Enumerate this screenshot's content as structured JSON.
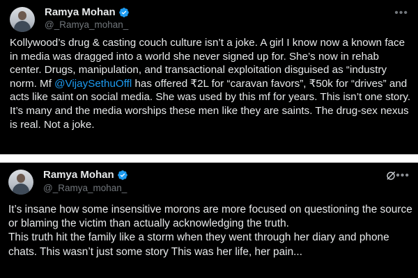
{
  "colors": {
    "background": "#000000",
    "text": "#e7e9ea",
    "muted": "#71767b",
    "link": "#1d9bf0",
    "verified": "#1d9bf0"
  },
  "tweets": [
    {
      "author": {
        "name": "Ramya Mohan",
        "handle": "@_Ramya_mohan_",
        "verified_icon": "verified-badge-icon",
        "avatar_icon": "avatar-icon"
      },
      "more_icon": "more-horizontal-icon",
      "text_before_mention": "Kollywood’s drug & casting couch culture isn’t a joke. A girl I know now a known face in media was dragged into a world she never signed up for. She’s now in  rehab center. Drugs, manipulation, and transactional exploitation disguised as “industry norm. Mf ",
      "mention": "@VijaySethuOffl",
      "text_after_mention": " has offered ₹2L for “caravan favors”, ₹50k for “drives” and acts like saint on social media. She was used by this mf for years. This isn’t one story. It’s many and the media worships these men like they are saints. The drug-sex nexus is real. Not a joke."
    },
    {
      "author": {
        "name": "Ramya Mohan",
        "handle": "@_Ramya_mohan_",
        "verified_icon": "verified-badge-icon",
        "avatar_icon": "avatar-icon"
      },
      "grok_icon": "grok-icon",
      "more_icon": "more-horizontal-icon",
      "text_line1": "It’s insane how some insensitive morons are more focused on questioning the source or blaming the victim than actually acknowledging the truth.",
      "text_line2": "This truth hit the family like a storm when they went through her diary and phone chats. This wasn’t just some story This was her life, her pain..."
    }
  ]
}
